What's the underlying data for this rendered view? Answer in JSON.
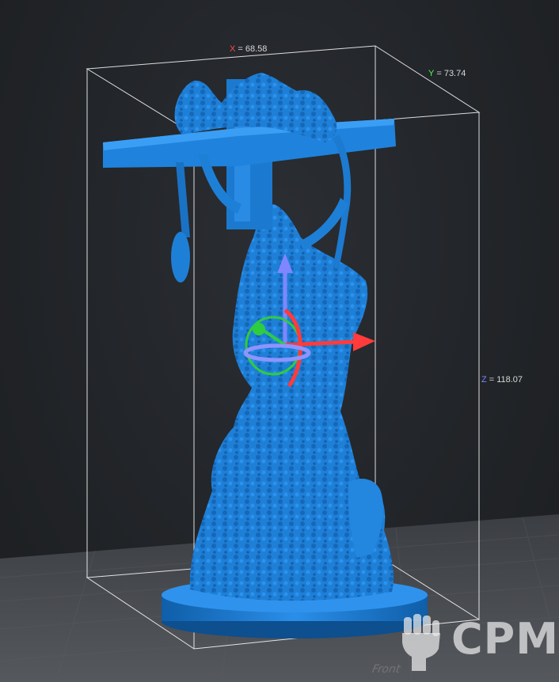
{
  "dimensions": {
    "x": {
      "axis": "X",
      "value": "= 68.58"
    },
    "y": {
      "axis": "Y",
      "value": "= 73.74"
    },
    "z": {
      "axis": "Z",
      "value": "= 118.07"
    }
  },
  "watermark": {
    "text": "CPM",
    "icon": "raised-fist-icon"
  },
  "floor_label": "Front",
  "colors": {
    "model": "#1e7fd6",
    "x_axis": "#ff3b3b",
    "y_axis": "#2ecc40",
    "z_axis": "#7f86ff",
    "bounding_box": "#ffffff",
    "background": "#23262a",
    "build_plate": "#44474c"
  },
  "gizmo": {
    "icons": [
      "move-gizmo-icon",
      "rotate-gizmo-icon"
    ]
  }
}
